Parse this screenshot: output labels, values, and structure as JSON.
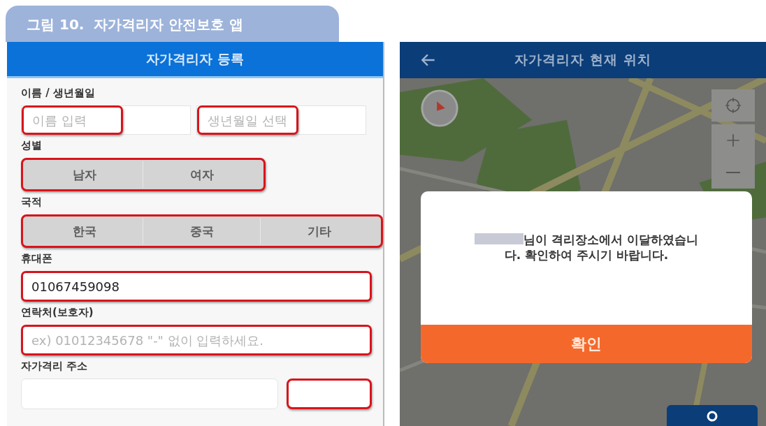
{
  "figure_caption": "그림 10.  자가격리자 안전보호 앱",
  "registration_screen": {
    "title": "자가격리자 등록",
    "sections": [
      {
        "label": "이름 / 생년월일",
        "kind": "pair",
        "fields": [
          {
            "placeholder": "이름 입력",
            "highlighted": true
          },
          {
            "placeholder": "생년월일 선택",
            "highlighted": true
          }
        ]
      },
      {
        "label": "성별",
        "kind": "segments",
        "highlighted": true,
        "options": [
          {
            "label": "남자",
            "selected": false
          },
          {
            "label": "여자",
            "selected": false
          }
        ]
      },
      {
        "label": "국적",
        "kind": "segments",
        "highlighted": true,
        "options": [
          {
            "label": "한국",
            "selected": false
          },
          {
            "label": "중국",
            "selected": false
          },
          {
            "label": "기타",
            "selected": false
          }
        ]
      },
      {
        "label": "휴대폰",
        "kind": "input",
        "value": "01067459098",
        "highlighted": true
      },
      {
        "label": "연락처(보호자)",
        "kind": "input",
        "placeholder": "ex) 01012345678 \"-\" 없이 입력하세요.",
        "highlighted": true
      },
      {
        "label": "자가격리 주소",
        "kind": "address",
        "highlighted": true
      }
    ]
  },
  "location_screen": {
    "title": "자가격리자 현재 위치",
    "dialog": {
      "message": "님이 격리장소에서 이달하였습니다. 확인하여 주시기 바랍니다.",
      "confirm": "확인"
    }
  }
}
